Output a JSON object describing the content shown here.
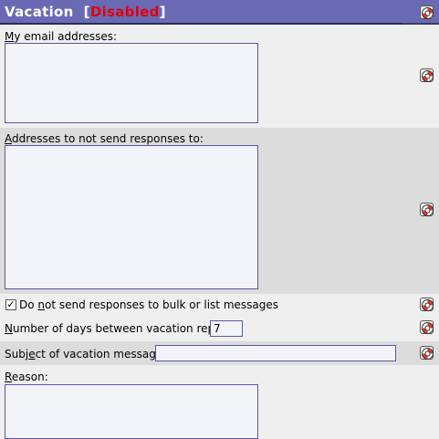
{
  "header": {
    "title": "Vacation",
    "bracket_open": "[",
    "status": "Disabled",
    "bracket_close": "]"
  },
  "fields": {
    "email_addresses": {
      "label_pre": "",
      "label_key": "M",
      "label_post": "y email addresses:",
      "value": ""
    },
    "no_response_addresses": {
      "label_pre": "",
      "label_key": "A",
      "label_post": "ddresses to not send responses to:",
      "value": ""
    },
    "bulk_checkbox": {
      "checked_mark": "✓",
      "label_pre": "Do ",
      "label_key": "n",
      "label_post": "ot send responses to bulk or list messages"
    },
    "days_between": {
      "label_pre": "",
      "label_key": "N",
      "label_post": "umber of days between vacation replies:",
      "value": "7"
    },
    "subject": {
      "label_pre": "Subj",
      "label_key": "e",
      "label_post": "ct of vacation message:",
      "value": ""
    },
    "reason": {
      "label_pre": "",
      "label_key": "R",
      "label_post": "eason:",
      "value": ""
    }
  },
  "icons": {
    "help": "help-lifebuoy-icon"
  },
  "colors": {
    "header_bg": "#6a6ab4",
    "status_red": "#e00010",
    "field_border": "#5858a8",
    "alt_row_bg": "#dcdcdc"
  }
}
